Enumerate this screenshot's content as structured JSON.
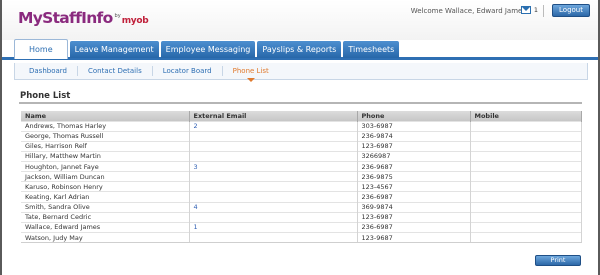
{
  "header": {
    "logo_text": "MyStaffInfo",
    "logo_by": "by",
    "logo_brand": "myob",
    "welcome": "Welcome Wallace, Edward James",
    "mail_count": "1",
    "logout_label": "Logout"
  },
  "tabs": [
    {
      "label": "Home",
      "active": true
    },
    {
      "label": "Leave Management",
      "active": false
    },
    {
      "label": "Employee Messaging",
      "active": false
    },
    {
      "label": "Payslips & Reports",
      "active": false
    },
    {
      "label": "Timesheets",
      "active": false
    }
  ],
  "subnav": [
    {
      "label": "Dashboard",
      "active": false
    },
    {
      "label": "Contact Details",
      "active": false
    },
    {
      "label": "Locator Board",
      "active": false
    },
    {
      "label": "Phone List",
      "active": true
    }
  ],
  "page_title": "Phone List",
  "table": {
    "columns": [
      "Name",
      "External Email",
      "Phone",
      "Mobile"
    ],
    "rows": [
      [
        "Andrews, Thomas Harley",
        "2",
        "303-6987",
        ""
      ],
      [
        "George, Thomas Russell",
        "",
        "236-9874",
        ""
      ],
      [
        "Giles, Harrison Relf",
        "",
        "123-6987",
        ""
      ],
      [
        "Hillary, Matthew Martin",
        "",
        "3266987",
        ""
      ],
      [
        "Houghton, Jannet Faye",
        "3",
        "236-9687",
        ""
      ],
      [
        "Jackson, William Duncan",
        "",
        "236-9875",
        ""
      ],
      [
        "Karuso, Robinson Henry",
        "",
        "123-4567",
        ""
      ],
      [
        "Keating, Karl Adrian",
        "",
        "236-6987",
        ""
      ],
      [
        "Smith, Sandra Olive",
        "4",
        "369-9874",
        ""
      ],
      [
        "Tate, Bernard Cedric",
        "",
        "123-6987",
        ""
      ],
      [
        "Wallace, Edward James",
        "1",
        "236-6987",
        ""
      ],
      [
        "Watson, Judy May",
        "",
        "123-9687",
        ""
      ]
    ]
  },
  "print_label": "Print",
  "colors": {
    "brand_purple": "#8a2a7e",
    "tab_blue": "#2e6fb3",
    "active_subnav": "#e07a2e"
  }
}
